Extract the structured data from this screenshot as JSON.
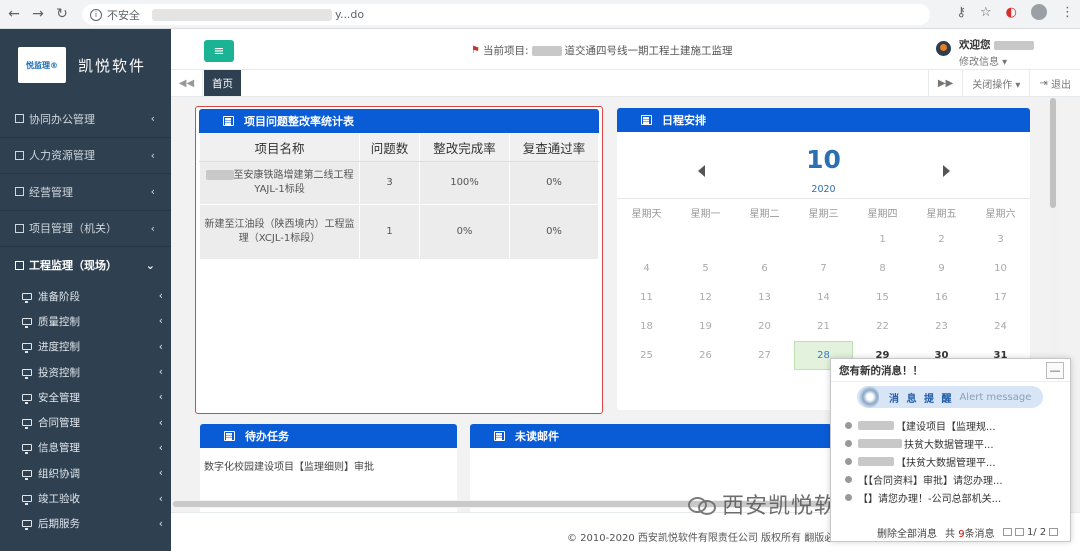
{
  "browser": {
    "insecure_label": "不安全",
    "url_tail": "y...do"
  },
  "sidebar": {
    "logo_text": "悦监理®",
    "brand": "凯悦软件",
    "menu": [
      {
        "label": "协同办公管理"
      },
      {
        "label": "人力资源管理"
      },
      {
        "label": "经营管理"
      },
      {
        "label": "项目管理（机关）"
      },
      {
        "label": "工程监理（现场）"
      }
    ],
    "submenu": [
      {
        "label": "准备阶段"
      },
      {
        "label": "质量控制"
      },
      {
        "label": "进度控制"
      },
      {
        "label": "投资控制"
      },
      {
        "label": "安全管理"
      },
      {
        "label": "合同管理"
      },
      {
        "label": "信息管理"
      },
      {
        "label": "组织协调"
      },
      {
        "label": "竣工验收"
      },
      {
        "label": "后期服务"
      }
    ]
  },
  "header": {
    "project_prefix": "当前项目:",
    "project_name": "道交通四号线一期工程土建施工监理",
    "welcome": "欢迎您",
    "edit_info": "修改信息 ▾"
  },
  "tabs": {
    "home": "首页",
    "close_ops": "关闭操作 ▾",
    "logout": "退出"
  },
  "stats_panel": {
    "title": "项目问题整改率统计表",
    "columns": [
      "项目名称",
      "问题数",
      "整改完成率",
      "复查通过率"
    ],
    "rows": [
      {
        "name": "至安康铁路增建第二线工程YAJL-1标段",
        "count": "3",
        "rate": "100%",
        "pass": "0%"
      },
      {
        "name": "新建至江油段（陕西境内）工程监理（XCJL-1标段）",
        "count": "1",
        "rate": "0%",
        "pass": "0%"
      }
    ]
  },
  "calendar": {
    "title": "日程安排",
    "month": "10",
    "year": "2020",
    "weekdays": [
      "星期天",
      "星期一",
      "星期二",
      "星期三",
      "星期四",
      "星期五",
      "星期六"
    ],
    "weeks": [
      [
        "",
        "",
        "",
        "",
        "1",
        "2",
        "3"
      ],
      [
        "4",
        "5",
        "6",
        "7",
        "8",
        "9",
        "10"
      ],
      [
        "11",
        "12",
        "13",
        "14",
        "15",
        "16",
        "17"
      ],
      [
        "18",
        "19",
        "20",
        "21",
        "22",
        "23",
        "24"
      ],
      [
        "25",
        "26",
        "27",
        "28",
        "29",
        "30",
        "31"
      ]
    ],
    "today": "28"
  },
  "todo_panel": {
    "title": "待办任务",
    "items": [
      "数字化校园建设项目【监理细则】审批"
    ]
  },
  "mail_panel": {
    "title": "未读邮件"
  },
  "footer": {
    "copyright": "© 2010-2020 西安凯悦软件有限责任公司 版权所有 翻版必"
  },
  "alert": {
    "header": "您有新的消息！！",
    "minimize": "—",
    "banner_title": "消 息 提 醒",
    "banner_sub": "Alert message",
    "items": [
      "【建设项目【监理规...",
      "扶贫大数据管理平...",
      "【扶贫大数据管理平...",
      "【【合同资料】审批】请您办理...",
      "【】请您办理！-公司总部机关..."
    ],
    "delete_all": "删除全部消息",
    "total_prefix": "共",
    "total_count": "9",
    "total_suffix": "条消息",
    "page": "1/ 2"
  },
  "watermark": "西安凯悦软件有限责任公司",
  "colors": {
    "sidebar_bg": "#2f4050",
    "accent_green": "#1ab394",
    "panel_head_blue": "#0a5cd6",
    "stats_border_red": "#e04545"
  }
}
